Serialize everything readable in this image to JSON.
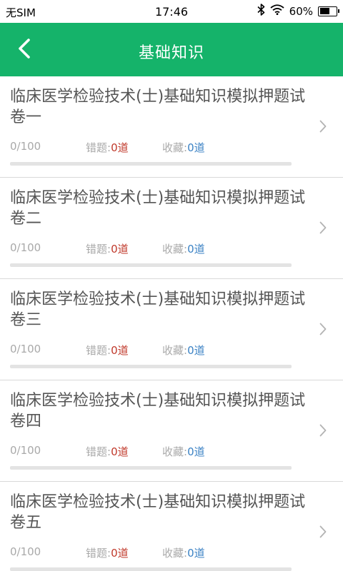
{
  "status": {
    "carrier": "无SIM",
    "time": "17:46",
    "battery": "60%",
    "battery_level": 0.6
  },
  "header": {
    "title": "基础知识",
    "back_icon": "chevron-left-icon",
    "color": "#15b36a"
  },
  "items": [
    {
      "title": "临床医学检验技术(士)基础知识模拟押题试卷一",
      "progress": "0/100",
      "progress_fraction": 0,
      "wrong_label": "错题:",
      "wrong_value": "0道",
      "fav_label": "收藏:",
      "fav_value": "0道"
    },
    {
      "title": "临床医学检验技术(士)基础知识模拟押题试卷二",
      "progress": "0/100",
      "progress_fraction": 0,
      "wrong_label": "错题:",
      "wrong_value": "0道",
      "fav_label": "收藏:",
      "fav_value": "0道"
    },
    {
      "title": "临床医学检验技术(士)基础知识模拟押题试卷三",
      "progress": "0/100",
      "progress_fraction": 0,
      "wrong_label": "错题:",
      "wrong_value": "0道",
      "fav_label": "收藏:",
      "fav_value": "0道"
    },
    {
      "title": "临床医学检验技术(士)基础知识模拟押题试卷四",
      "progress": "0/100",
      "progress_fraction": 0,
      "wrong_label": "错题:",
      "wrong_value": "0道",
      "fav_label": "收藏:",
      "fav_value": "0道"
    },
    {
      "title": "临床医学检验技术(士)基础知识模拟押题试卷五",
      "progress": "0/100",
      "progress_fraction": 0,
      "wrong_label": "错题:",
      "wrong_value": "0道",
      "fav_label": "收藏:",
      "fav_value": "0道"
    }
  ]
}
